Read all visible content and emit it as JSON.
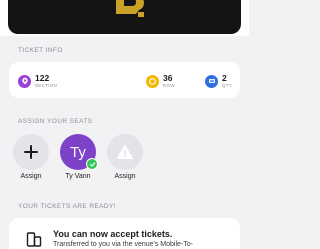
{
  "ticket_info": {
    "heading": "TICKET INFO",
    "section": {
      "value": "122",
      "label": "SECTION",
      "icon": "location-pin-icon",
      "color": "#9b3fd6"
    },
    "row": {
      "value": "36",
      "label": "ROW",
      "icon": "row-coin-icon",
      "color": "#f2b705"
    },
    "qty": {
      "value": "2",
      "label": "QTY",
      "icon": "ticket-count-icon",
      "color": "#2f6fe0"
    }
  },
  "assign_seats": {
    "heading": "ASSIGN YOUR SEATS",
    "seats": [
      {
        "label": "Assign",
        "icon": "plus-icon"
      },
      {
        "label": "Ty Vann",
        "initials": "Ty",
        "icon": "check-badge-icon",
        "avatar_color": "#7d42c8",
        "badge_color": "#34c759"
      },
      {
        "label": "Assign",
        "icon": "warning-icon"
      }
    ]
  },
  "ready": {
    "heading": "YOUR TICKETS ARE READY!",
    "title": "You can now accept tickets.",
    "body": "Transferred to you via the venue's Mobile-To-",
    "icon": "phone-tickets-icon"
  }
}
